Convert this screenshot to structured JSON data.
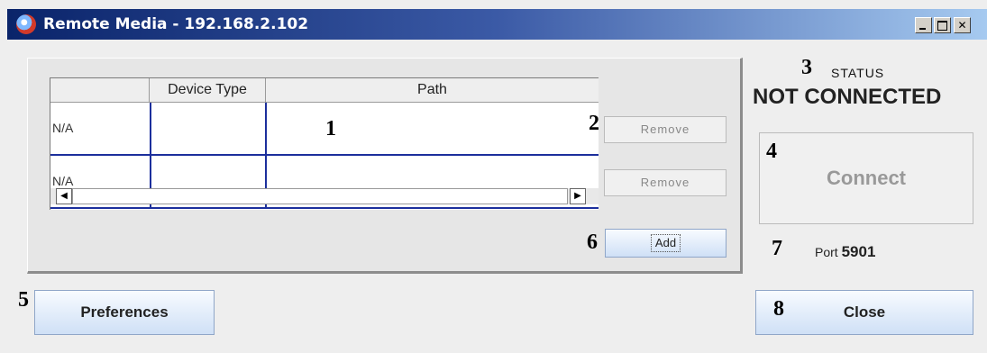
{
  "window": {
    "title": "Remote Media - 192.168.2.102",
    "min_icon": "minimize-icon",
    "max_icon": "maximize-icon",
    "close_glyph": "✕"
  },
  "table": {
    "headers": [
      "",
      "Device Type",
      "Path"
    ],
    "rows": [
      {
        "id": "N/A",
        "device_type": "",
        "path": ""
      },
      {
        "id": "N/A",
        "device_type": "",
        "path": ""
      }
    ],
    "scroll_left": "◀",
    "scroll_right": "▶"
  },
  "buttons": {
    "remove": "Remove",
    "add": "Add",
    "preferences": "Preferences",
    "close": "Close",
    "connect": "Connect"
  },
  "status": {
    "label": "STATUS",
    "value": "NOT CONNECTED"
  },
  "port": {
    "label": "Port",
    "value": "5901"
  },
  "callouts": [
    "1",
    "2",
    "3",
    "4",
    "5",
    "6",
    "7",
    "8"
  ]
}
